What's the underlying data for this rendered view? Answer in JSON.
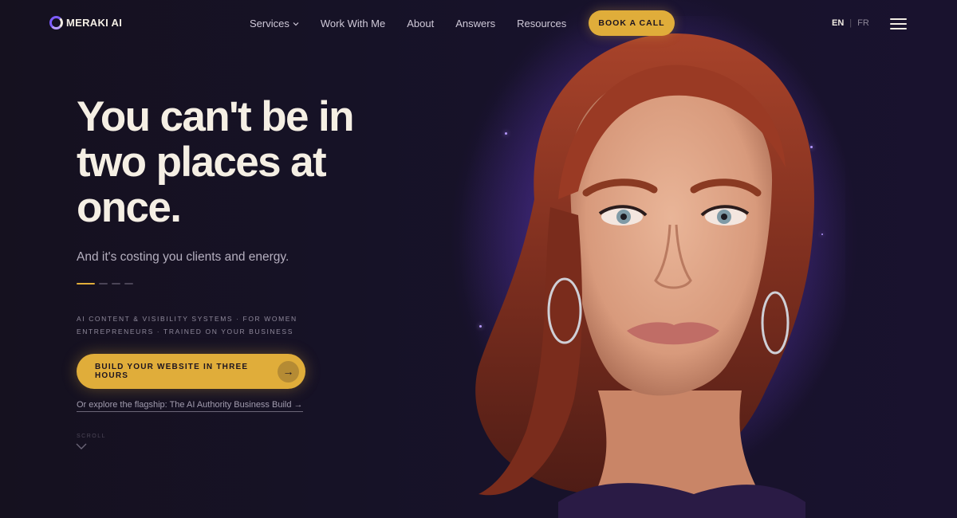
{
  "brand": {
    "name": "MERAKI AI",
    "logo_icon": "ring-logo-icon",
    "accent": "#e0ad3a",
    "glow": "#7d5cff",
    "background": "#15111f"
  },
  "nav": {
    "links": [
      {
        "label": "Services",
        "has_dropdown": true
      },
      {
        "label": "Work With Me"
      },
      {
        "label": "About"
      },
      {
        "label": "Answers"
      },
      {
        "label": "Resources"
      }
    ],
    "cta_label": "BOOK A CALL",
    "lang_active": "EN",
    "lang_other": "FR",
    "menu_icon": "hamburger-menu-icon"
  },
  "hero": {
    "headline_lines": [
      "You can't be in",
      "two places at",
      "once."
    ],
    "subhead": "And it's costing you clients and energy.",
    "eyebrow_line1": "AI CONTENT & VISIBILITY SYSTEMS · FOR WOMEN",
    "eyebrow_line2": "ENTREPRENEURS · TRAINED ON YOUR BUSINESS",
    "cta_label": "BUILD YOUR WEBSITE IN THREE HOURS",
    "cta_arrow": "→",
    "explore_link": "Or explore the flagship: The AI Authority Business Build →",
    "scroll_label": "SCROLL",
    "slide_indicator": {
      "active": 1,
      "total": 4
    }
  },
  "portrait": {
    "alt": "Portrait of a red-haired woman with hoop earrings against a purple glow"
  }
}
